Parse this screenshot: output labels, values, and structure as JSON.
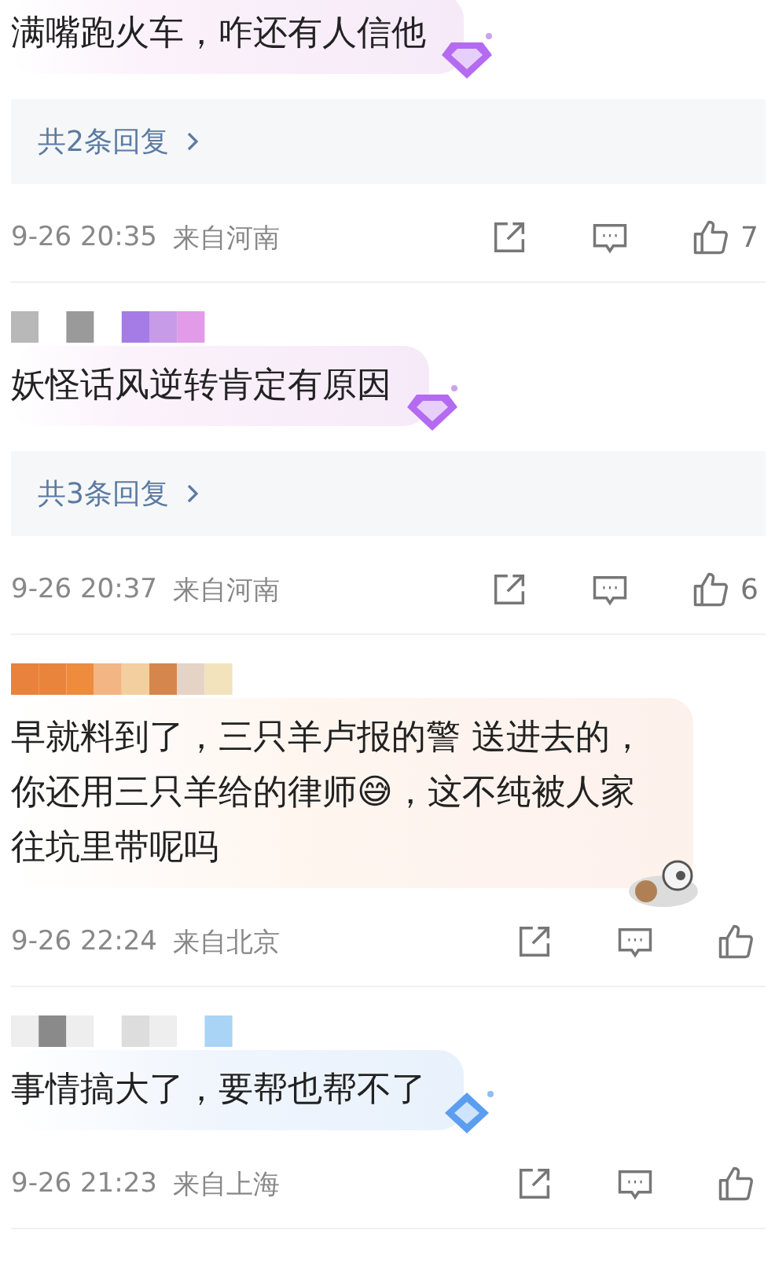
{
  "comments": [
    {
      "author_shown": false,
      "text": "满嘴跑火车，咋还有人信他",
      "kind": "amethyst",
      "replies": "共2条回复",
      "time": "9-26 20:35",
      "location": "来自河南",
      "likes": "7"
    },
    {
      "author_shown": true,
      "text": "妖怪话风逆转肯定有原因",
      "kind": "amethyst",
      "replies": "共3条回复",
      "time": "9-26 20:37",
      "location": "来自河南",
      "likes": "6"
    },
    {
      "author_shown": true,
      "text": "早就料到了，三只羊卢报的警 送进去的，你还用三只羊给的律师😅，这不纯被人家往坑里带呢吗",
      "kind": "mascot",
      "time": "9-26 22:24",
      "location": "来自北京"
    },
    {
      "author_shown": true,
      "text": "事情搞大了，要帮也帮不了",
      "kind": "sapphire",
      "time": "9-26 21:23",
      "location": "来自上海"
    }
  ]
}
